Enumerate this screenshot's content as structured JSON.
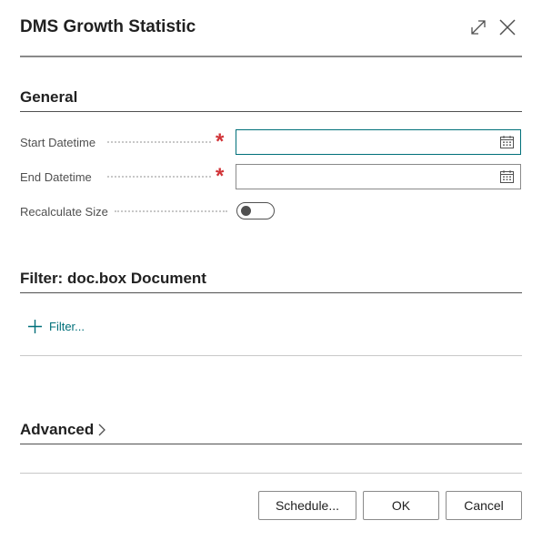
{
  "dialog": {
    "title": "DMS Growth Statistic",
    "icons": {
      "expand": "expand-icon",
      "close": "close-icon"
    }
  },
  "general": {
    "title": "General",
    "fields": {
      "start_datetime": {
        "label": "Start Datetime",
        "value": "",
        "required": true,
        "icon": "calendar-icon"
      },
      "end_datetime": {
        "label": "End Datetime",
        "value": "",
        "required": true,
        "icon": "calendar-icon"
      },
      "recalculate_size": {
        "label": "Recalculate Size",
        "checked": false
      }
    },
    "required_marker": "*"
  },
  "filter_section": {
    "title": "Filter: doc.box Document",
    "add_filter_label": "Filter...",
    "icon": "plus-icon"
  },
  "advanced": {
    "title": "Advanced",
    "icon": "chevron-right-icon"
  },
  "footer": {
    "schedule_label": "Schedule...",
    "ok_label": "OK",
    "cancel_label": "Cancel"
  },
  "colors": {
    "accent": "#00707a",
    "required": "#d13438",
    "text": "#212121",
    "label": "#505050"
  }
}
